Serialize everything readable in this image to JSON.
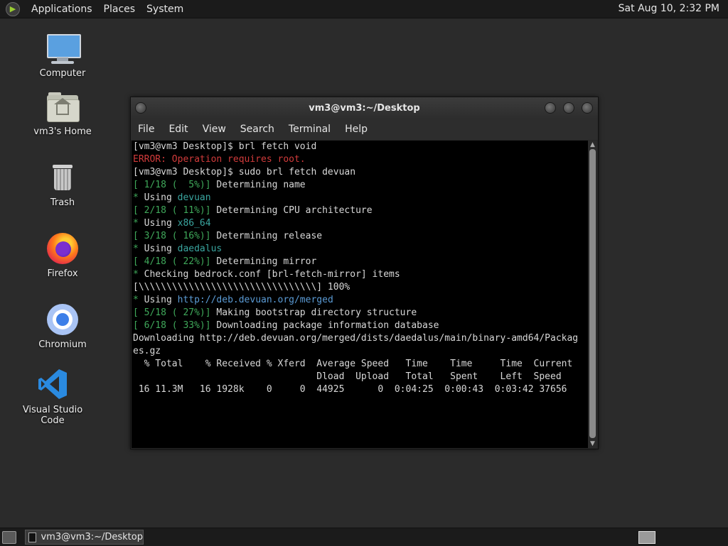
{
  "top_panel": {
    "menus": [
      "Applications",
      "Places",
      "System"
    ],
    "clock": "Sat Aug 10,  2:32 PM"
  },
  "desktop_icons": [
    {
      "label": "Computer",
      "icon": "computer-icon"
    },
    {
      "label": "vm3's Home",
      "icon": "home-folder-icon"
    },
    {
      "label": "Trash",
      "icon": "trash-icon"
    },
    {
      "label": "Firefox",
      "icon": "firefox-icon"
    },
    {
      "label": "Chromium",
      "icon": "chromium-icon"
    },
    {
      "label": "Visual Studio Code",
      "icon": "vscode-icon"
    }
  ],
  "terminal": {
    "title": "vm3@vm3:~/Desktop",
    "menu": [
      "File",
      "Edit",
      "View",
      "Search",
      "Terminal",
      "Help"
    ],
    "lines": [
      [
        {
          "t": "[vm3@vm3 Desktop]$ brl fetch void",
          "c": ""
        }
      ],
      [
        {
          "t": "ERROR: Operation requires root.",
          "c": "red"
        }
      ],
      [
        {
          "t": "[vm3@vm3 Desktop]$ sudo brl fetch devuan",
          "c": ""
        }
      ],
      [
        {
          "t": "[ 1/18 (  5%)]",
          "c": "green"
        },
        {
          "t": " Determining name",
          "c": ""
        }
      ],
      [
        {
          "t": "*",
          "c": "green"
        },
        {
          "t": " Using ",
          "c": ""
        },
        {
          "t": "devuan",
          "c": "teal"
        }
      ],
      [
        {
          "t": "[ 2/18 ( 11%)]",
          "c": "green"
        },
        {
          "t": " Determining CPU architecture",
          "c": ""
        }
      ],
      [
        {
          "t": "*",
          "c": "green"
        },
        {
          "t": " Using ",
          "c": ""
        },
        {
          "t": "x86_64",
          "c": "teal"
        }
      ],
      [
        {
          "t": "[ 3/18 ( 16%)]",
          "c": "green"
        },
        {
          "t": " Determining release",
          "c": ""
        }
      ],
      [
        {
          "t": "*",
          "c": "green"
        },
        {
          "t": " Using ",
          "c": ""
        },
        {
          "t": "daedalus",
          "c": "teal"
        }
      ],
      [
        {
          "t": "[ 4/18 ( 22%)]",
          "c": "green"
        },
        {
          "t": " Determining mirror",
          "c": ""
        }
      ],
      [
        {
          "t": "*",
          "c": "green"
        },
        {
          "t": " Checking bedrock.conf [brl-fetch-mirror] items",
          "c": ""
        }
      ],
      [
        {
          "t": "[\\\\\\\\\\\\\\\\\\\\\\\\\\\\\\\\\\\\\\\\\\\\\\\\\\\\\\\\\\\\\\\\] 100%",
          "c": ""
        }
      ],
      [
        {
          "t": "*",
          "c": "green"
        },
        {
          "t": " Using ",
          "c": ""
        },
        {
          "t": "http://deb.devuan.org/merged",
          "c": "blue"
        }
      ],
      [
        {
          "t": "[ 5/18 ( 27%)]",
          "c": "green"
        },
        {
          "t": " Making bootstrap directory structure",
          "c": ""
        }
      ],
      [
        {
          "t": "[ 6/18 ( 33%)]",
          "c": "green"
        },
        {
          "t": " Downloading package information database",
          "c": ""
        }
      ],
      [
        {
          "t": "Downloading http://deb.devuan.org/merged/dists/daedalus/main/binary-amd64/Packag",
          "c": ""
        }
      ],
      [
        {
          "t": "es.gz",
          "c": ""
        }
      ],
      [
        {
          "t": "  % Total    % Received % Xferd  Average Speed   Time    Time     Time  Current",
          "c": ""
        }
      ],
      [
        {
          "t": "                                 Dload  Upload   Total   Spent    Left  Speed",
          "c": ""
        }
      ],
      [
        {
          "t": " 16 11.3M   16 1928k    0     0  44925      0  0:04:25  0:00:43  0:03:42 37656",
          "c": ""
        }
      ]
    ]
  },
  "taskbar": {
    "task_label": "vm3@vm3:~/Desktop"
  },
  "colors": {
    "error_red": "#d23b3b",
    "progress_green": "#3fa85a",
    "value_teal": "#3aa6a0",
    "url_blue": "#5b9bd5"
  }
}
